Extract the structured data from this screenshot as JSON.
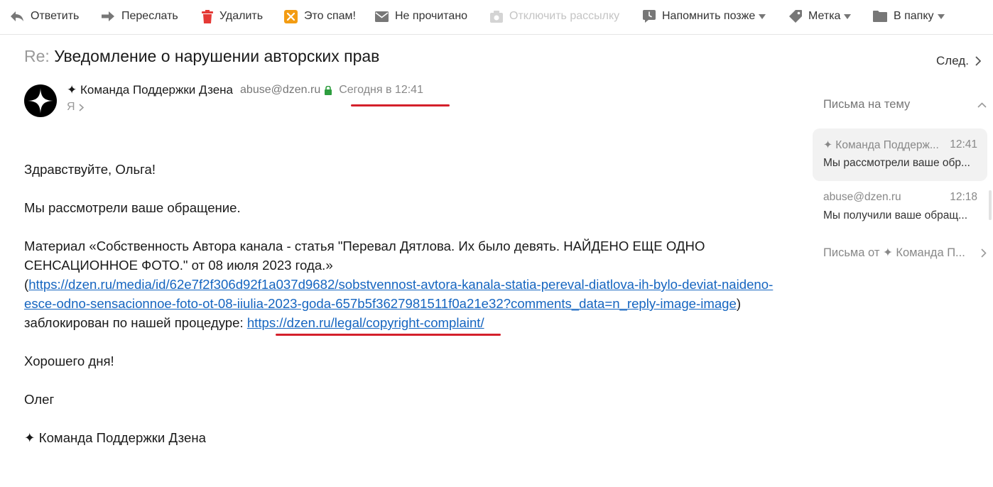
{
  "toolbar": {
    "reply": "Ответить",
    "forward": "Переслать",
    "delete": "Удалить",
    "spam": "Это спам!",
    "unread": "Не прочитано",
    "unsubscribe": "Отключить рассылку",
    "remind": "Напомнить позже",
    "label": "Метка",
    "folder": "В папку"
  },
  "colors": {
    "accent_red": "#d4202b",
    "link": "#1565c0",
    "secure_green": "#2e9e3f"
  },
  "message": {
    "subject_prefix": "Re:",
    "subject": "Уведомление о нарушении авторских прав",
    "next": "След.",
    "sender_name": "✦ Команда Поддержки Дзена",
    "sender_email": "abuse@dzen.ru",
    "date": "Сегодня в 12:41",
    "recipient": "Я",
    "greeting": "Здравствуйте, Ольга!",
    "line1": "Мы рассмотрели ваше обращение.",
    "material_text": "Материал «Собственность Автора канала - статья \"Перевал Дятлова. Их было девять. НАЙДЕНО ЕЩЕ ОДНО СЕНСАЦИОННОЕ ФОТО.\" от 08 июля 2023 года.»",
    "paren_open": "(",
    "material_link": "https://dzen.ru/media/id/62e7f2f306d92f1a037d9682/sobstvennost-avtora-kanala-statia-pereval-diatlova-ih-bylo-deviat-naideno-esce-odno-sensacionnoe-foto-ot-08-iiulia-2023-goda-657b5f3627981511f0a21e32?comments_data=n_reply-image-image",
    "paren_close": ")",
    "blocked_text": "заблокирован по нашей процедуре",
    "colon": ":",
    "policy_link": "https://dzen.ru/legal/copyright-complaint/",
    "closing": "Хорошего дня!",
    "signature_name": "Олег",
    "signature_team": "✦ Команда Поддержки Дзена"
  },
  "sidebar": {
    "thread_title": "Письма на тему",
    "items": [
      {
        "sender": "✦ Команда Поддерж...",
        "time": "12:41",
        "snippet": "Мы рассмотрели ваше обр..."
      },
      {
        "sender": "abuse@dzen.ru",
        "time": "12:18",
        "snippet": "Мы получили ваше обращ..."
      }
    ],
    "letters_from": "Письма от ✦ Команда П..."
  }
}
